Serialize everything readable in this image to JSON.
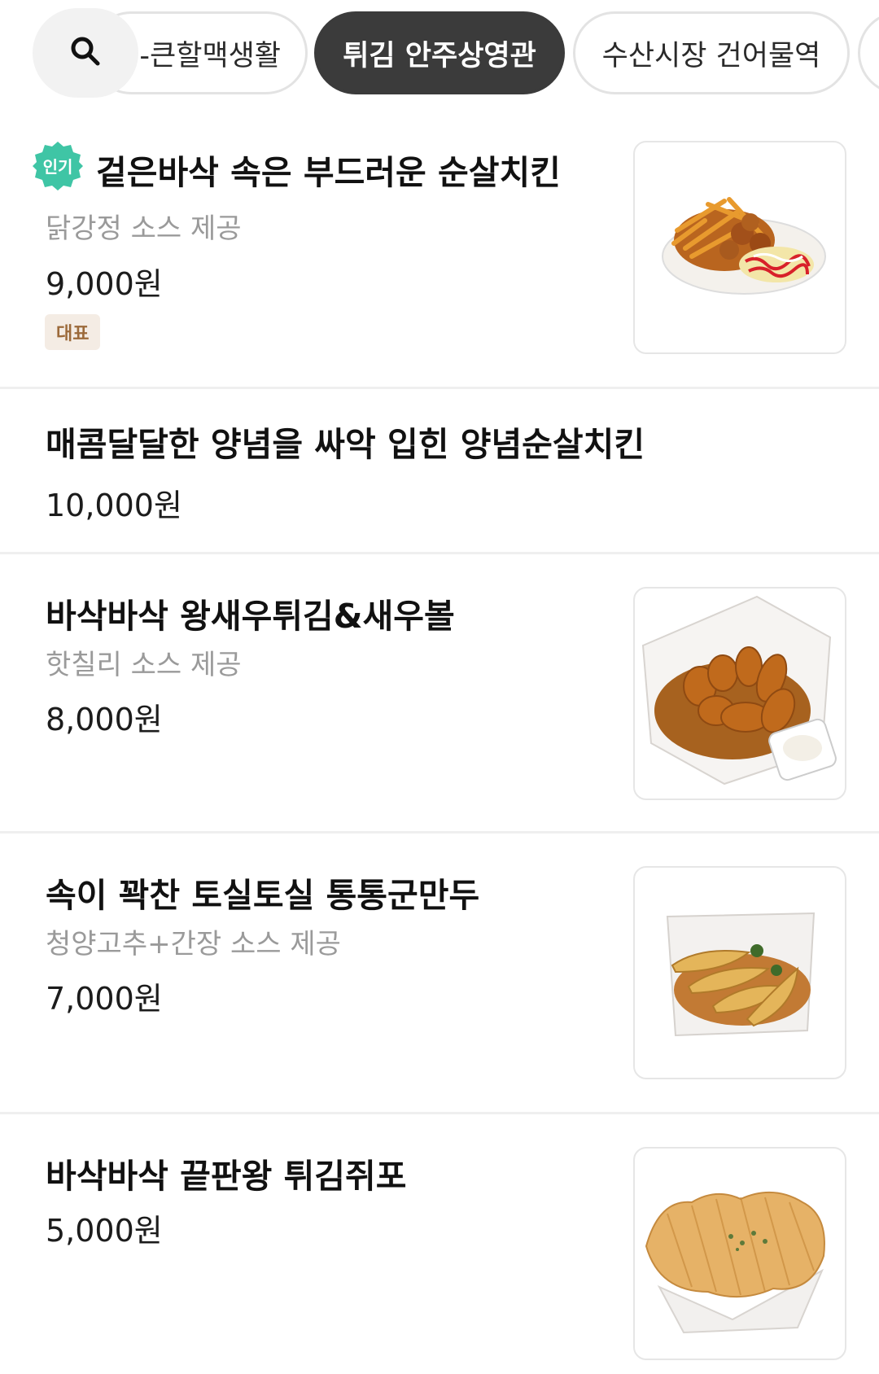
{
  "categories": [
    {
      "label": "-큰할맥생활",
      "active": false
    },
    {
      "label": "튀김 안주상영관",
      "active": true
    },
    {
      "label": "수산시장 건어물역",
      "active": false
    },
    {
      "label": "",
      "active": false
    }
  ],
  "search": {
    "icon": "search-icon"
  },
  "menu": [
    {
      "badge": "인기",
      "name": "겉은바삭 속은 부드러운 순살치킨",
      "desc": "닭강정 소스 제공",
      "price": "9,000원",
      "tag": "대표",
      "image": "fried-chicken-fries-photo"
    },
    {
      "name": "매콤달달한 양념을 싸악 입힌 양념순살치킨",
      "price": "10,000원"
    },
    {
      "name": "바삭바삭 왕새우튀김&새우볼",
      "desc": "핫칠리 소스 제공",
      "price": "8,000원",
      "image": "fried-shrimp-basket-photo"
    },
    {
      "name": "속이 꽉찬 토실토실 통통군만두",
      "desc": "청양고추+간장 소스 제공",
      "price": "7,000원",
      "image": "fried-dumplings-photo"
    },
    {
      "name": "바삭바삭 끝판왕 튀김쥐포",
      "price": "5,000원",
      "image": "fried-filefish-jerky-photo"
    }
  ],
  "colors": {
    "active_chip": "#3b3b3b",
    "popular_badge": "#3fc5a5",
    "rep_tag_bg": "#f4ece4",
    "rep_tag_text": "#9c6a3a"
  }
}
